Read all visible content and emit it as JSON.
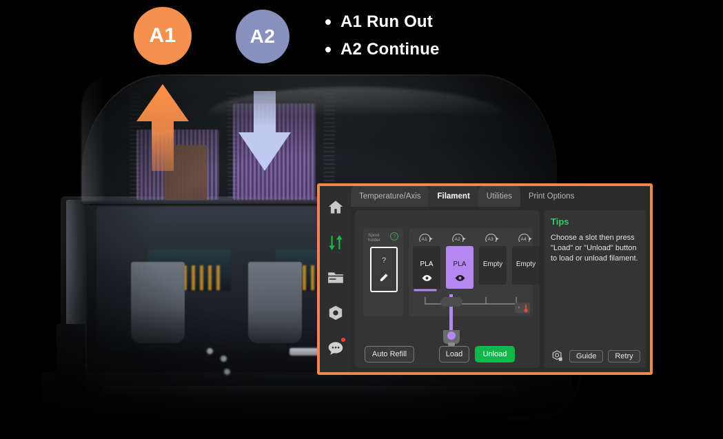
{
  "callouts": {
    "badges": [
      {
        "label": "A1",
        "color": "#f4914e",
        "name": "badge-a1"
      },
      {
        "label": "A2",
        "color": "#8891bd",
        "name": "badge-a2"
      }
    ],
    "bullets": [
      {
        "text": "A1 Run Out"
      },
      {
        "text": "A2 Continue"
      }
    ],
    "arrows": [
      {
        "direction": "up",
        "color": "#f79248",
        "name": "arrow-up-a1"
      },
      {
        "direction": "down",
        "color": "#c3cbf0",
        "name": "arrow-down-a2"
      }
    ]
  },
  "panel": {
    "accent_color": "#f2874a",
    "sidebar": [
      {
        "icon": "home-icon",
        "active": false
      },
      {
        "icon": "sliders-icon",
        "active": true
      },
      {
        "icon": "folder-icon",
        "active": false
      },
      {
        "icon": "nozzle-icon",
        "active": false
      },
      {
        "icon": "chat-icon",
        "active": false,
        "badge": true
      }
    ],
    "tabs": [
      {
        "label": "Temperature/Axis",
        "active": false
      },
      {
        "label": "Filament",
        "active": true
      },
      {
        "label": "Utilities",
        "active": false
      },
      {
        "label": "Print Options",
        "active": false
      }
    ],
    "spool_holder": {
      "label": "Spool\nholder",
      "help": "?",
      "slot_value": "?",
      "edit_icon": "pencil-icon"
    },
    "slots": [
      {
        "tag": "A1",
        "material": "PLA",
        "color": "#2e2e2e",
        "text_color": "#ffffff",
        "eye": "eye-icon-light",
        "selected": false,
        "empty": false
      },
      {
        "tag": "A2",
        "material": "PLA",
        "color": "#b388f0",
        "text_color": "#1a1a1a",
        "eye": "eye-icon-dark",
        "selected": true,
        "empty": false
      },
      {
        "tag": "A3",
        "material": "Empty",
        "color": "#2e2e2e",
        "text_color": "#e6e6e6",
        "eye": "",
        "selected": false,
        "empty": true
      },
      {
        "tag": "A4",
        "material": "Empty",
        "color": "#2e2e2e",
        "text_color": "#e6e6e6",
        "eye": "",
        "selected": false,
        "empty": true
      }
    ],
    "humidity_icon": "humidity-thermometer-icon",
    "buttons": {
      "auto_refill": "Auto Refill",
      "load": "Load",
      "unload": "Unload"
    },
    "tips": {
      "title": "Tips",
      "text": "Choose a slot then press \"Load\" or \"Unload\" button to load or unload filament.",
      "magnifier_icon": "magnifier-nozzle-icon",
      "guide": "Guide",
      "retry": "Retry"
    }
  }
}
